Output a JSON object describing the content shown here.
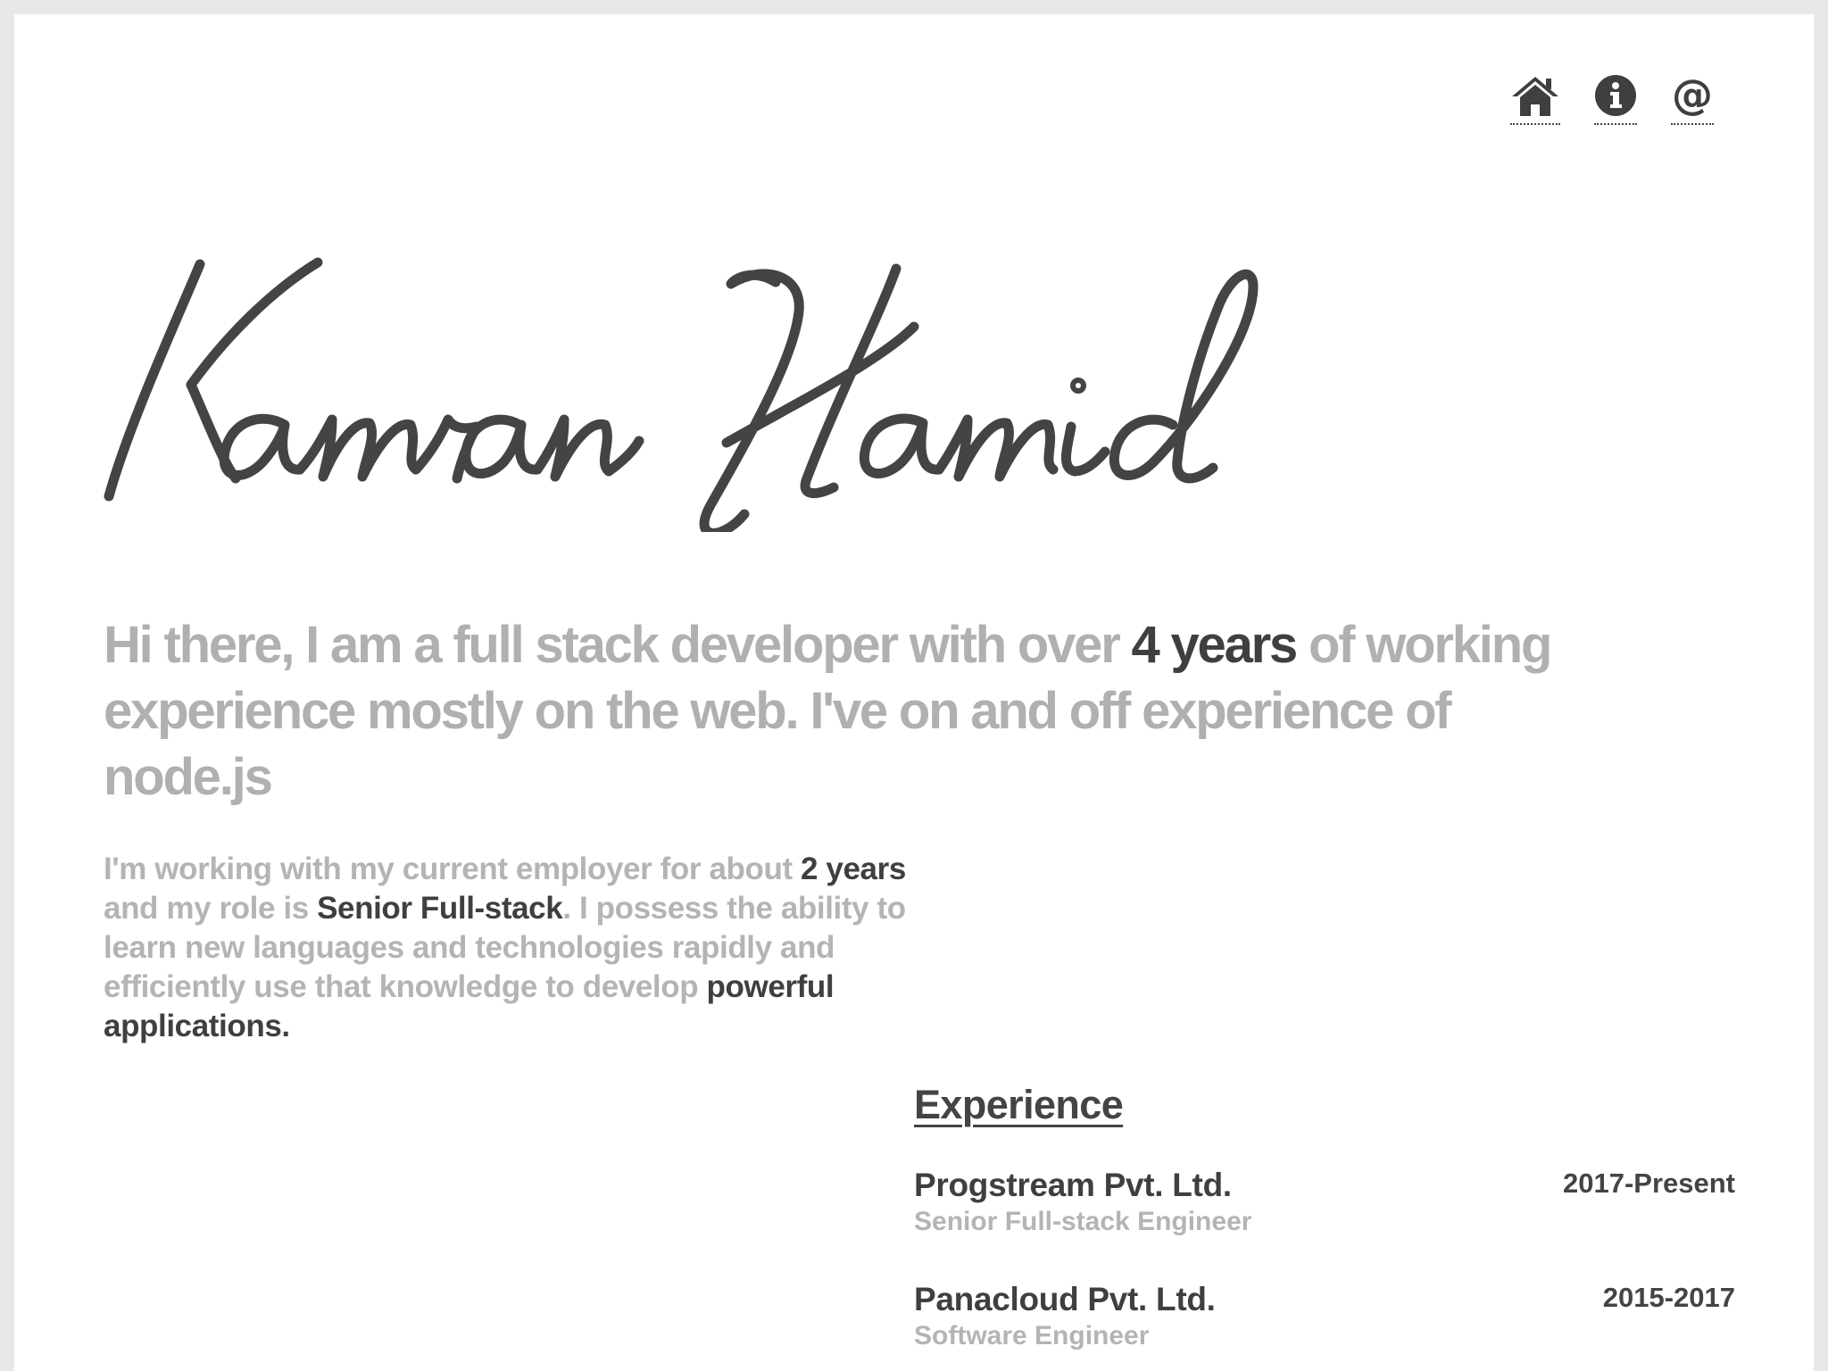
{
  "nav": {
    "items": [
      {
        "icon": "home-icon",
        "label": "Home"
      },
      {
        "icon": "info-icon",
        "label": "About"
      },
      {
        "icon": "at-icon",
        "label": "Contact"
      }
    ]
  },
  "signature": {
    "text": "Kamran Hamid"
  },
  "intro": {
    "part1": "Hi there, I am a full stack developer with over ",
    "highlight": "4 years",
    "part2": " of working experience mostly on the web. I've on and off experience of node.js"
  },
  "about": {
    "part1": "I'm working with my current employer for about ",
    "highlight1": "2 years",
    "part2": "  and my role is ",
    "highlight2": "Senior Full-stack",
    "part3": ". I possess the ability to learn new languages and technologies rapidly and efficiently use that knowledge to develop ",
    "highlight3": "powerful applications."
  },
  "experience": {
    "title": "Experience",
    "jobs": [
      {
        "company": "Progstream Pvt. Ltd.",
        "role": "Senior Full-stack Engineer",
        "period": "2017-Present"
      },
      {
        "company": "Panacloud Pvt. Ltd.",
        "role": "Software Engineer",
        "period": "2015-2017"
      }
    ]
  },
  "colors": {
    "text_dark": "#3f3f3f",
    "text_muted": "#b0b0b0",
    "background": "#ffffff",
    "frame": "#e8e8e8"
  }
}
